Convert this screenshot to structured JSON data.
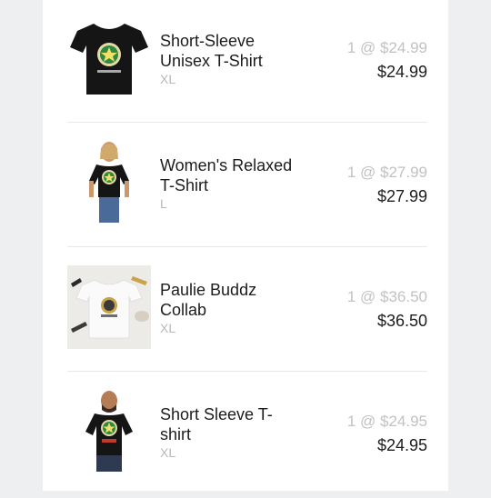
{
  "cart": {
    "items": [
      {
        "name": "Short-Sleeve Unisex T-Shirt",
        "variant": "XL",
        "quantity_price": "1 @ $24.99",
        "total": "$24.99",
        "image": "black-tshirt-star-logo",
        "colors": {
          "shirt": "#151515",
          "emblem": "#2e8b3d"
        }
      },
      {
        "name": "Women's Relaxed T-Shirt",
        "variant": "L",
        "quantity_price": "1 @ $27.99",
        "total": "$27.99",
        "image": "woman-model-black-tshirt",
        "colors": {
          "shirt": "#151515",
          "emblem": "#2e8b3d"
        }
      },
      {
        "name": "Paulie Buddz Collab",
        "variant": "XL",
        "quantity_price": "1 @ $36.50",
        "total": "$36.50",
        "image": "white-tshirt-flatlay",
        "colors": {
          "shirt": "#f7f7f7",
          "emblem": "#c9a24a"
        }
      },
      {
        "name": "Short Sleeve T-shirt",
        "variant": "XL",
        "quantity_price": "1 @ $24.95",
        "total": "$24.95",
        "image": "man-model-black-tshirt",
        "colors": {
          "shirt": "#151515",
          "emblem": "#2e8b3d"
        }
      }
    ]
  }
}
